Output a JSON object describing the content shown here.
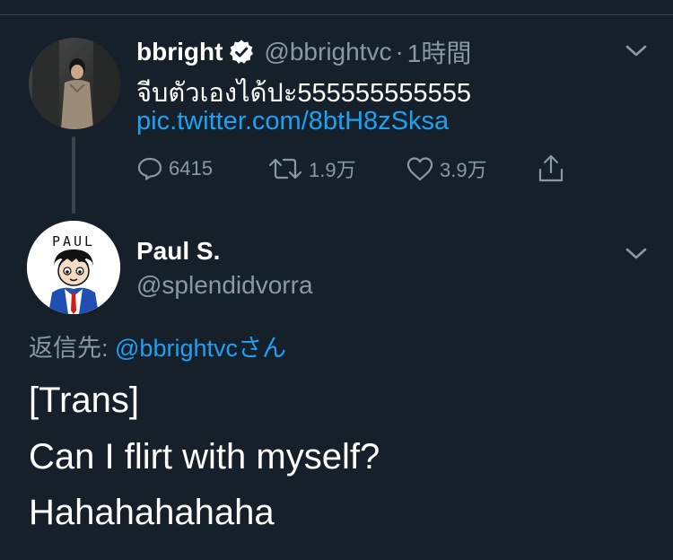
{
  "tweet": {
    "display_name": "bbright",
    "handle": "@bbrightvc",
    "separator": "·",
    "time": "1時間",
    "text": "จีบตัวเองได้ปะ555555555555",
    "link": "pic.twitter.com/8btH8zSksa",
    "replies": "6415",
    "retweets": "1.9万",
    "likes": "3.9万"
  },
  "reply": {
    "display_name": "Paul S.",
    "handle": "@splendidvorra",
    "avatar_text": "PAUL",
    "reply_label": "返信先: ",
    "reply_mention": "@bbrightvc",
    "reply_suffix": "さん",
    "lines": [
      "[Trans]",
      "Can I flirt with myself?",
      "Hahahahahaha"
    ]
  },
  "colors": {
    "background": "#15202b",
    "muted": "#8899a6",
    "link": "#1da1f2",
    "divider": "#38444d"
  }
}
